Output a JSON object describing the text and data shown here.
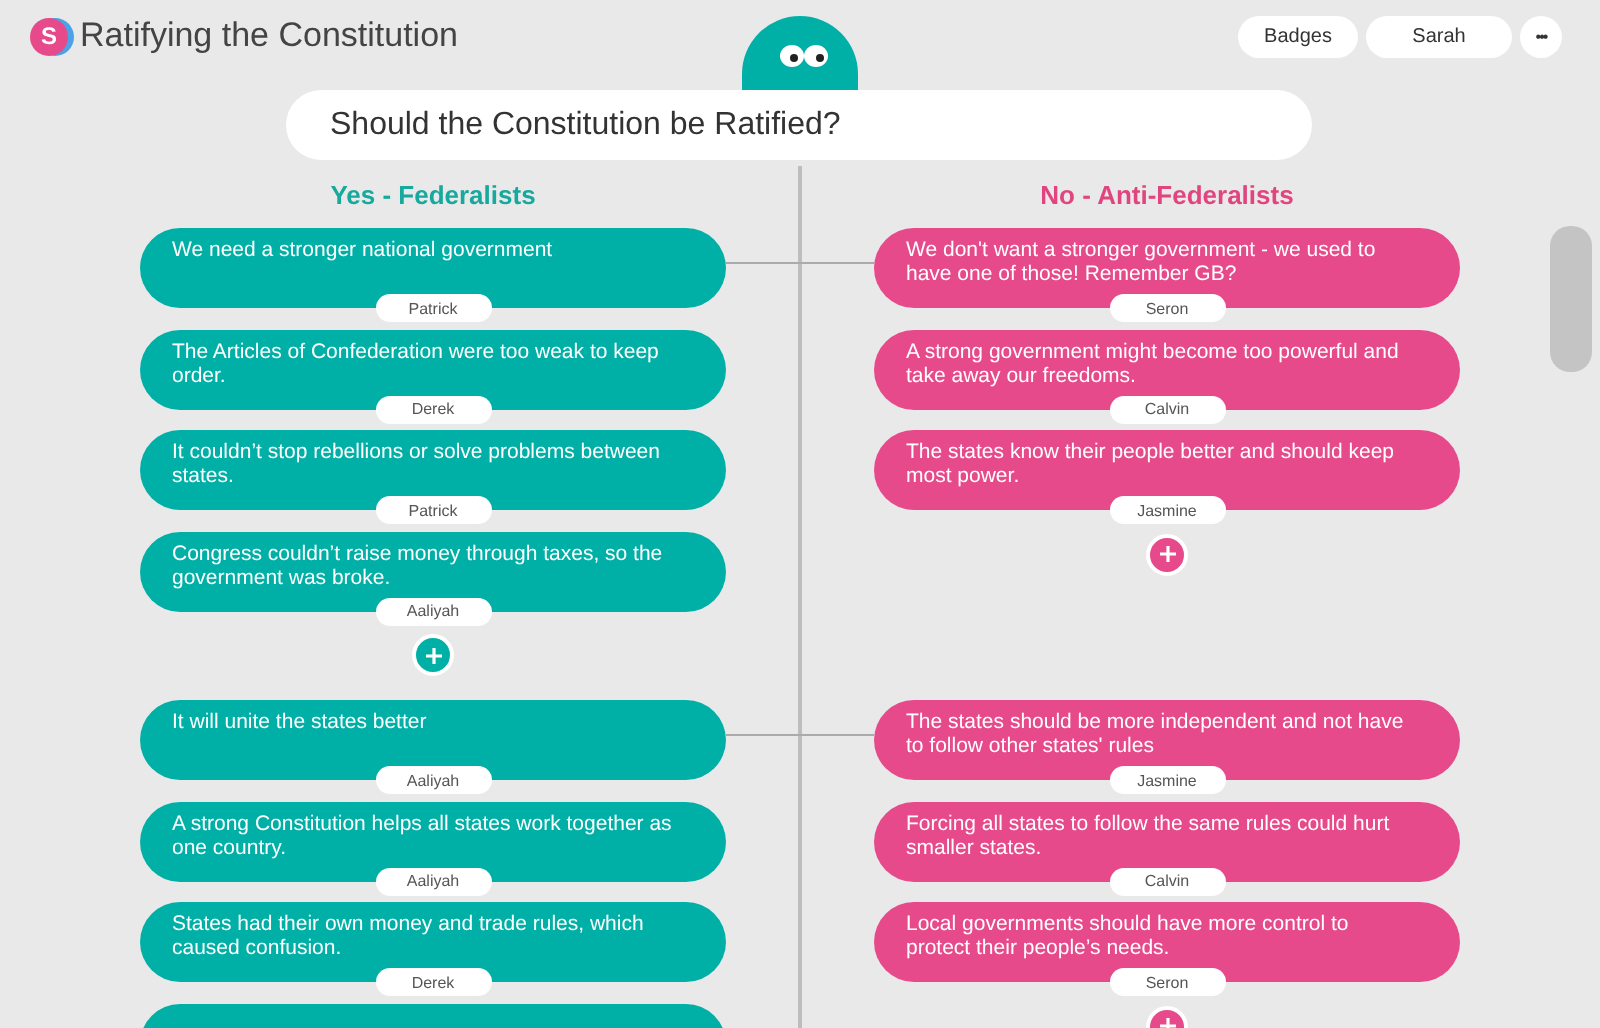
{
  "header": {
    "logo": "S",
    "title": "Ratifying the Constitution",
    "buttons": [
      "Badges",
      "Sarah"
    ],
    "more": "•••"
  },
  "question": "Should the Constitution be Ratified?",
  "columns": [
    {
      "heading": "Yes - Federalists"
    },
    {
      "heading": "No - Anti-Federalists"
    }
  ],
  "groups": [
    {
      "yes": {
        "cards": [
          {
            "text": "We need a stronger national government",
            "author": "Patrick"
          },
          {
            "text": "The Articles of Confederation were too weak to keep order.",
            "author": "Derek"
          },
          {
            "text": "It couldn’t stop rebellions or solve problems between states.",
            "author": "Patrick"
          },
          {
            "text": "Congress couldn’t raise money through taxes, so the government was broke.",
            "author": "Aaliyah"
          }
        ],
        "add_button": true
      },
      "no": {
        "cards": [
          {
            "text": "We don't want a stronger government - we used to have one of those! Remember GB?",
            "author": "Seron"
          },
          {
            "text": "A strong government might become too powerful and take away our freedoms.",
            "author": "Calvin"
          },
          {
            "text": "The states know their people better and should keep most power.",
            "author": "Jasmine"
          }
        ],
        "add_button": true
      }
    },
    {
      "yes": {
        "cards": [
          {
            "text": "It will unite the states better",
            "author": "Aaliyah"
          },
          {
            "text": "A strong Constitution helps all states work together as one country.",
            "author": "Aaliyah"
          },
          {
            "text": "States had their own money and trade rules, which caused confusion.",
            "author": "Derek"
          }
        ],
        "cut_off_card": true
      },
      "no": {
        "cards": [
          {
            "text": "The states should be more independent and not have to follow other states' rules",
            "author": "Jasmine"
          },
          {
            "text": "Forcing all states to follow the same rules could hurt smaller states.",
            "author": "Calvin"
          },
          {
            "text": "Local governments should have more control to protect their people’s needs.",
            "author": "Seron"
          }
        ],
        "add_button": true
      }
    }
  ]
}
